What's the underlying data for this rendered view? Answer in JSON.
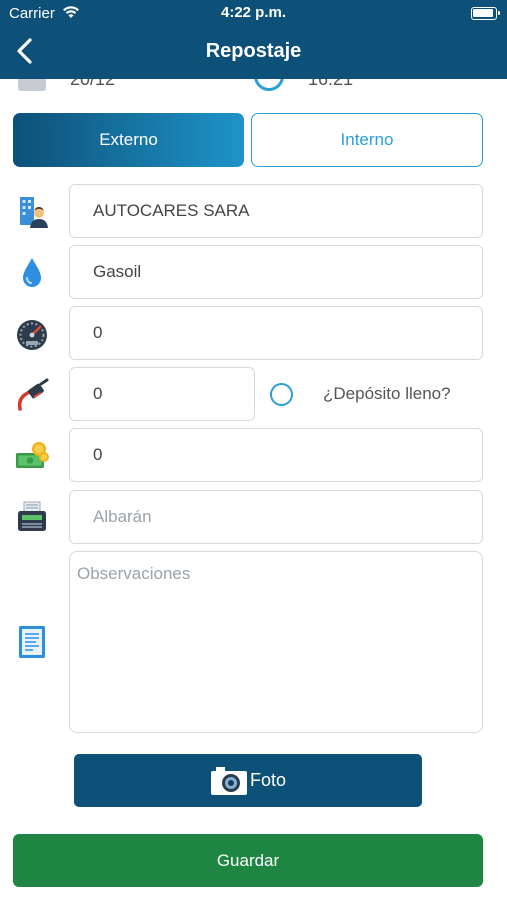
{
  "status_bar": {
    "carrier": "Carrier",
    "time": "4:22 p.m."
  },
  "header": {
    "title": "Repostaje"
  },
  "date_row": {
    "date": "20/12",
    "time": "16:21"
  },
  "tabs": [
    {
      "label": "Externo",
      "selected": true
    },
    {
      "label": "Interno",
      "selected": false
    }
  ],
  "form": {
    "company": "AUTOCARES SARA",
    "fuel_type": "Gasoil",
    "odometer": "0",
    "liters": "0",
    "full_tank_label": "¿Depósito lleno?",
    "amount": "0",
    "albaran_placeholder": "Albarán",
    "observations_placeholder": "Observaciones"
  },
  "buttons": {
    "photo": "Foto",
    "save": "Guardar"
  },
  "colors": {
    "header": "#0d5178",
    "accent": "#2a9fd6",
    "save": "#1e8543"
  }
}
